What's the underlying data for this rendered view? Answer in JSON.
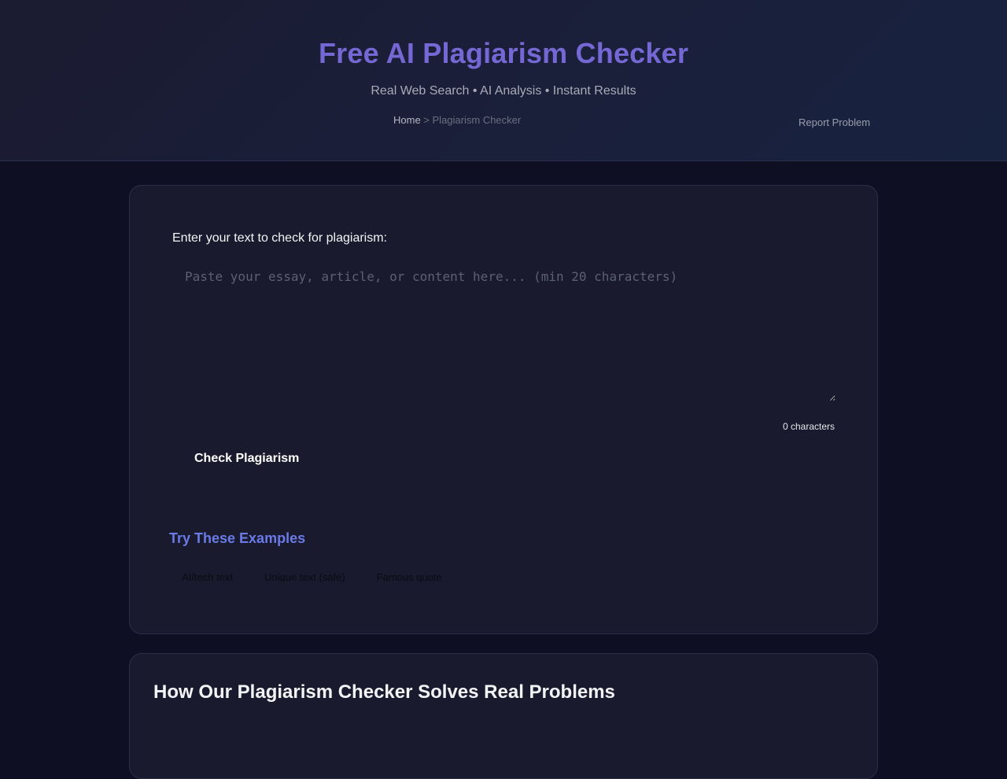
{
  "header": {
    "title": "Free AI Plagiarism Checker",
    "subtitle": "Real Web Search • AI Analysis • Instant Results",
    "breadcrumb": {
      "home": "Home",
      "separator": " > ",
      "current": "Plagiarism Checker"
    },
    "report_label": "Report Problem"
  },
  "checker": {
    "input_label": "Enter your text to check for plagiarism:",
    "input_placeholder": "Paste your essay, article, or content here... (min 20 characters)",
    "input_value": "",
    "char_count": "0 characters",
    "button_label": "Check Plagiarism"
  },
  "examples": {
    "title": "Try These Examples",
    "items": [
      {
        "label": "AI/tech text"
      },
      {
        "label": "Unique text (safe)"
      },
      {
        "label": "Famous quote"
      }
    ]
  },
  "info": {
    "title": "How Our Plagiarism Checker Solves Real Problems"
  },
  "colors": {
    "accent_title": "#7668d4",
    "accent_examples": "#6a7ae6",
    "page_background": "#0f0f23",
    "card_background": "#1a1a2e"
  }
}
